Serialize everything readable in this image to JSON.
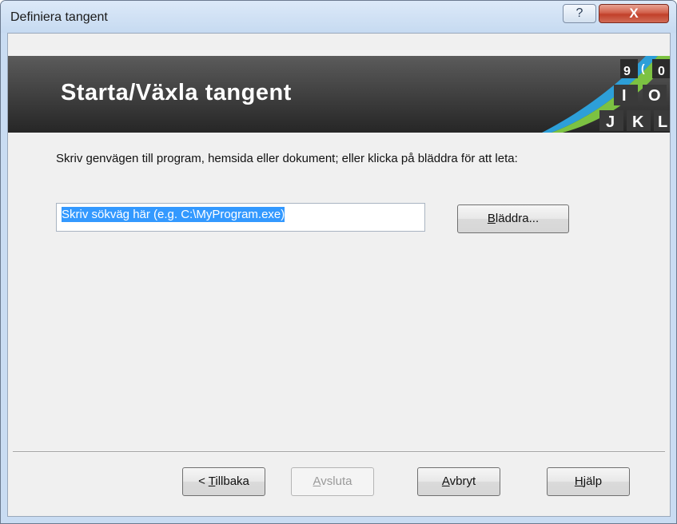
{
  "window": {
    "title": "Definiera tangent",
    "help_glyph": "?",
    "close_glyph": "X"
  },
  "banner": {
    "title": "Starta/Växla tangent",
    "logo_keys": [
      "9",
      "(",
      "0",
      "I",
      "O",
      "J",
      "K",
      "L"
    ]
  },
  "main": {
    "instruction": "Skriv genvägen till program, hemsida eller dokument; eller klicka på bläddra för att leta:",
    "path_input": {
      "value": "Skriv sökväg här (e.g. C:\\MyProgram.exe)"
    },
    "browse": {
      "mnemonic": "B",
      "rest": "läddra..."
    }
  },
  "footer": {
    "back": {
      "prefix": "< ",
      "mnemonic": "T",
      "rest": "illbaka"
    },
    "finish": {
      "mnemonic": "A",
      "rest": "vsluta",
      "disabled": true
    },
    "cancel": {
      "mnemonic": "A",
      "rest": "vbryt"
    },
    "help": {
      "mnemonic": "H",
      "rest": "jälp"
    }
  }
}
